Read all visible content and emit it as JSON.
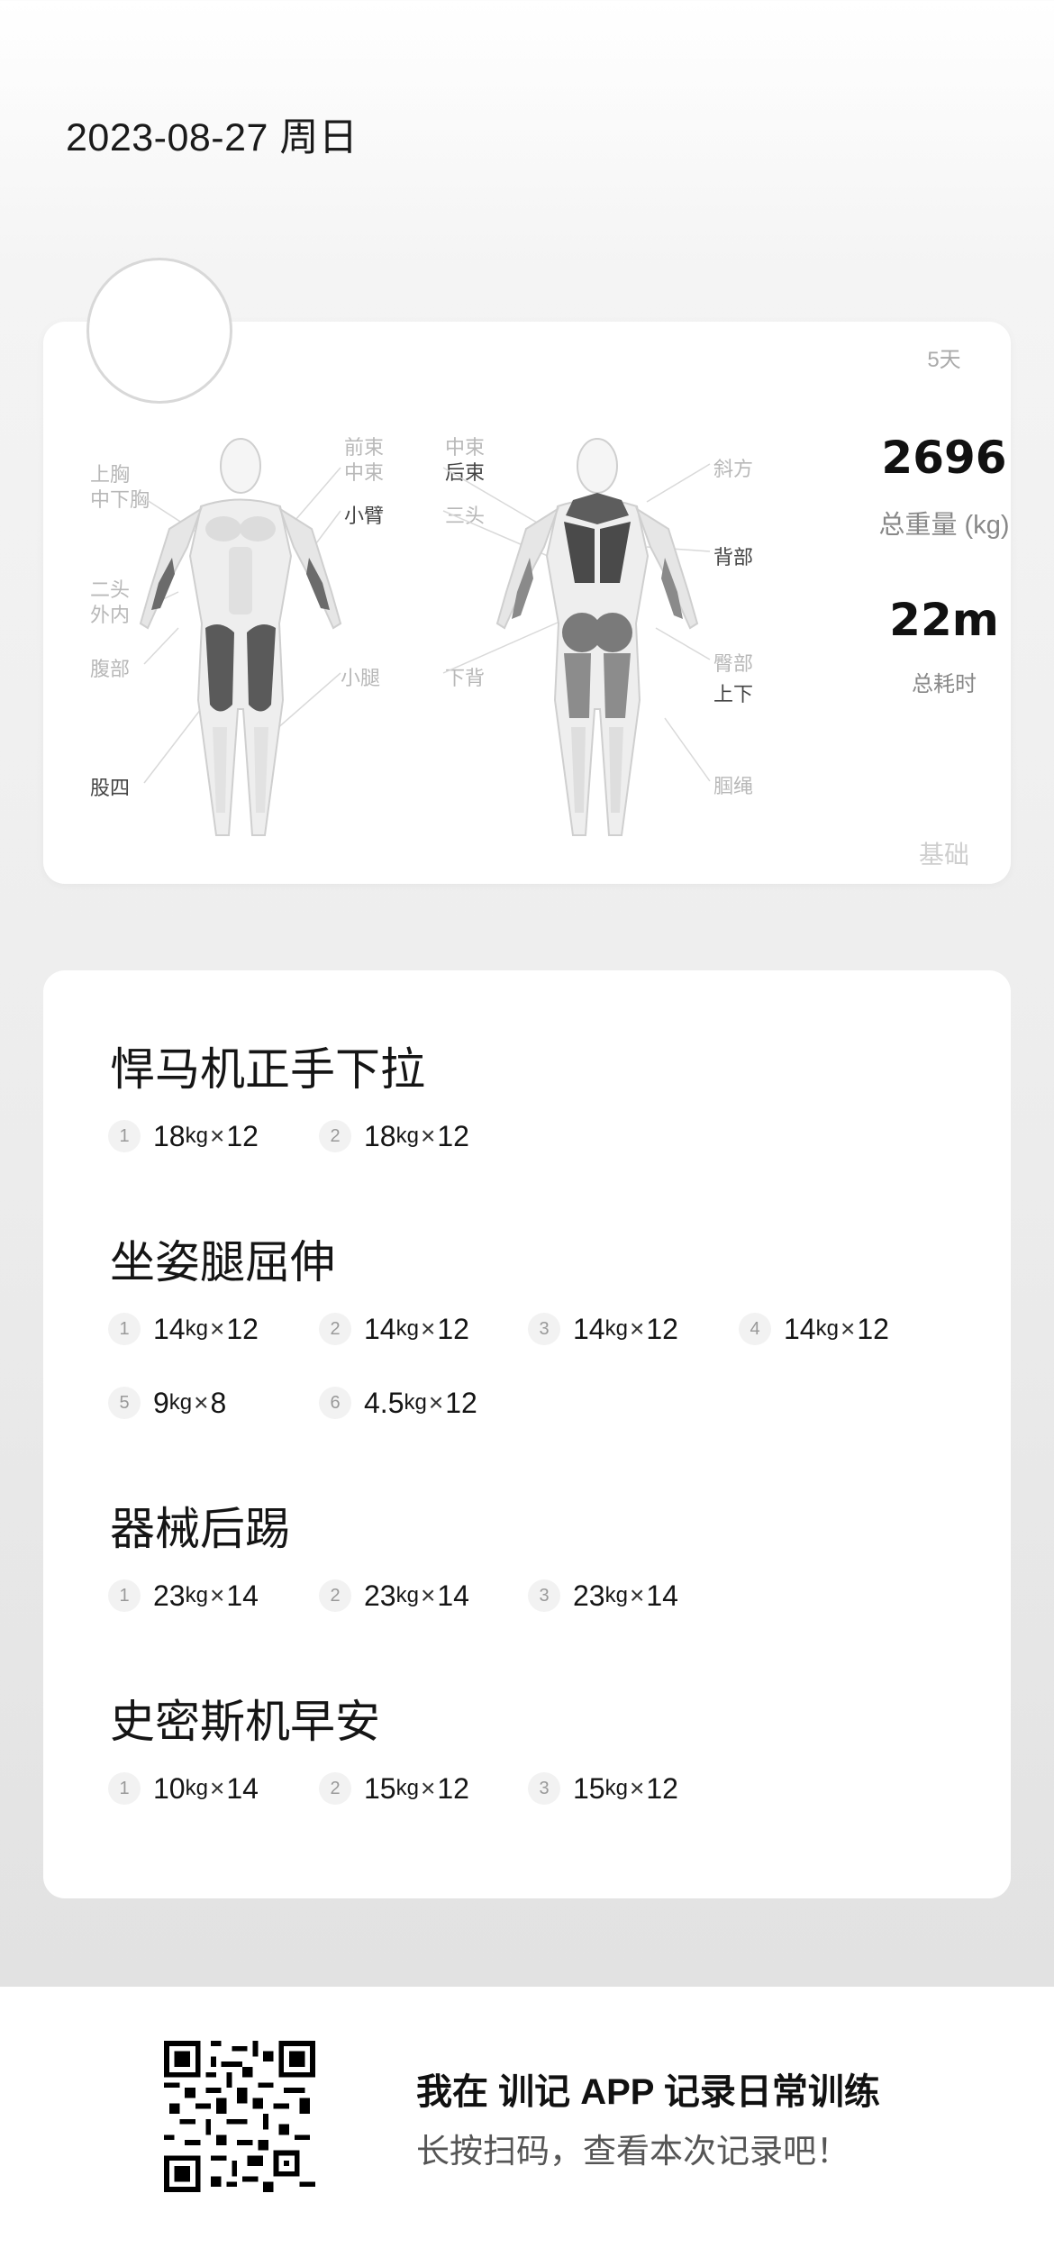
{
  "header": {
    "date": "2023-08-27 周日"
  },
  "summary": {
    "days": "5天",
    "total_weight_value": "2696",
    "total_weight_label": "总重量 (kg)",
    "total_time_value": "22m",
    "total_time_label": "总耗时",
    "level": "基础"
  },
  "muscles": {
    "front_left": [
      "上胸",
      "中下胸",
      "二头",
      "外内",
      "腹部",
      "股四"
    ],
    "front_right": [
      "前束",
      "中束",
      "小臂",
      "小腿"
    ],
    "back_left": [
      "中束",
      "后束",
      "三头",
      "下背"
    ],
    "back_right": [
      "斜方",
      "背部",
      "臀部",
      "上下",
      "腘绳"
    ]
  },
  "exercises": [
    {
      "name": "悍马机正手下拉",
      "sets": [
        {
          "n": "1",
          "w": "18",
          "u": "kg",
          "x": "×",
          "r": "12"
        },
        {
          "n": "2",
          "w": "18",
          "u": "kg",
          "x": "×",
          "r": "12"
        }
      ]
    },
    {
      "name": "坐姿腿屈伸",
      "sets": [
        {
          "n": "1",
          "w": "14",
          "u": "kg",
          "x": "×",
          "r": "12"
        },
        {
          "n": "2",
          "w": "14",
          "u": "kg",
          "x": "×",
          "r": "12"
        },
        {
          "n": "3",
          "w": "14",
          "u": "kg",
          "x": "×",
          "r": "12"
        },
        {
          "n": "4",
          "w": "14",
          "u": "kg",
          "x": "×",
          "r": "12"
        },
        {
          "n": "5",
          "w": "9",
          "u": "kg",
          "x": "×",
          "r": "8"
        },
        {
          "n": "6",
          "w": "4.5",
          "u": "kg",
          "x": "×",
          "r": "12"
        }
      ]
    },
    {
      "name": "器械后踢",
      "sets": [
        {
          "n": "1",
          "w": "23",
          "u": "kg",
          "x": "×",
          "r": "14"
        },
        {
          "n": "2",
          "w": "23",
          "u": "kg",
          "x": "×",
          "r": "14"
        },
        {
          "n": "3",
          "w": "23",
          "u": "kg",
          "x": "×",
          "r": "14"
        }
      ]
    },
    {
      "name": "史密斯机早安",
      "sets": [
        {
          "n": "1",
          "w": "10",
          "u": "kg",
          "x": "×",
          "r": "14"
        },
        {
          "n": "2",
          "w": "15",
          "u": "kg",
          "x": "×",
          "r": "12"
        },
        {
          "n": "3",
          "w": "15",
          "u": "kg",
          "x": "×",
          "r": "12"
        }
      ]
    }
  ],
  "footer": {
    "line1": "我在 训记 APP 记录日常训练",
    "line2": "长按扫码，查看本次记录吧！"
  }
}
